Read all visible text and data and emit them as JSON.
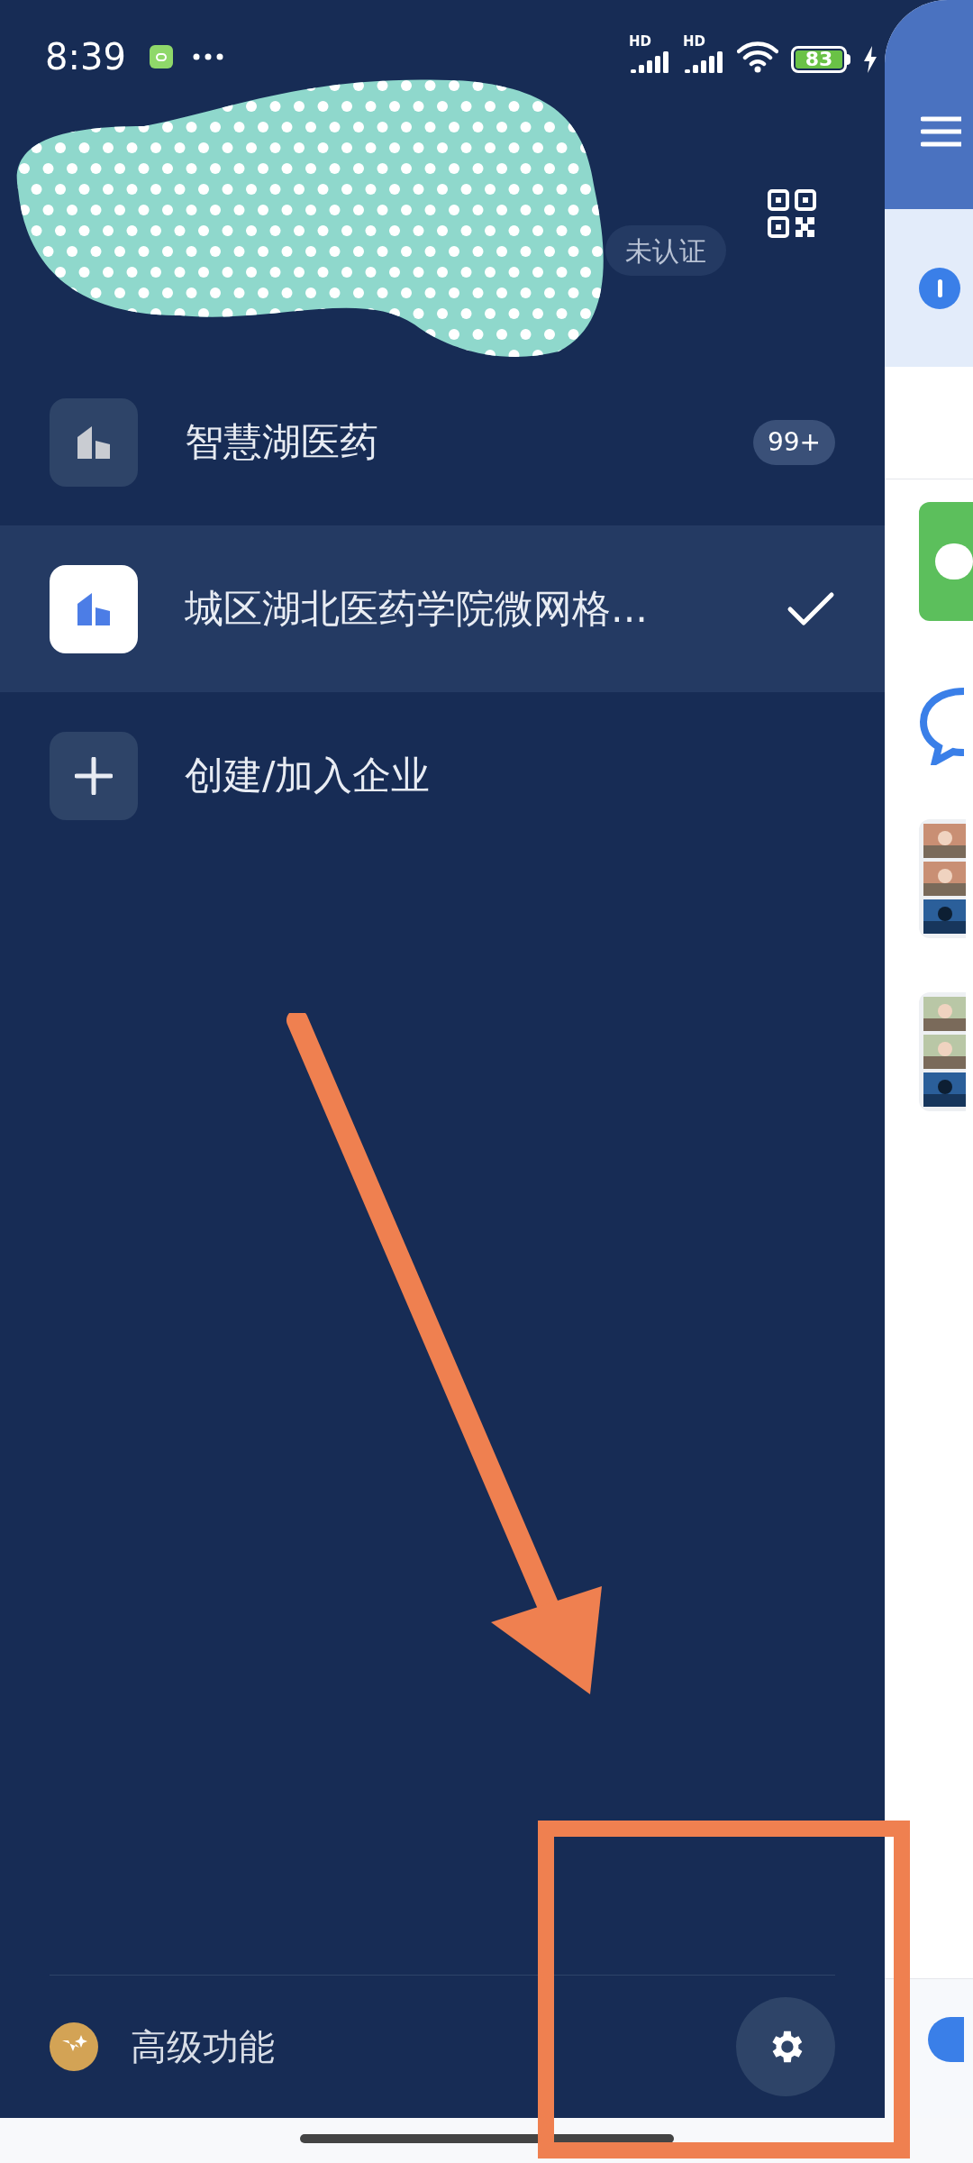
{
  "status_bar": {
    "time": "8:39",
    "signal_labels": [
      "HD",
      "HD"
    ],
    "battery": "83"
  },
  "profile": {
    "badge": "未认证"
  },
  "enterprises": [
    {
      "kind": "org",
      "name": "智慧湖医药",
      "badge": "99+",
      "selected": false
    },
    {
      "kind": "org",
      "name": "城区湖北医药学院微网格...",
      "selected": true
    },
    {
      "kind": "add",
      "name": "创建/加入企业",
      "selected": false
    }
  ],
  "footer": {
    "label": "高级功能"
  }
}
